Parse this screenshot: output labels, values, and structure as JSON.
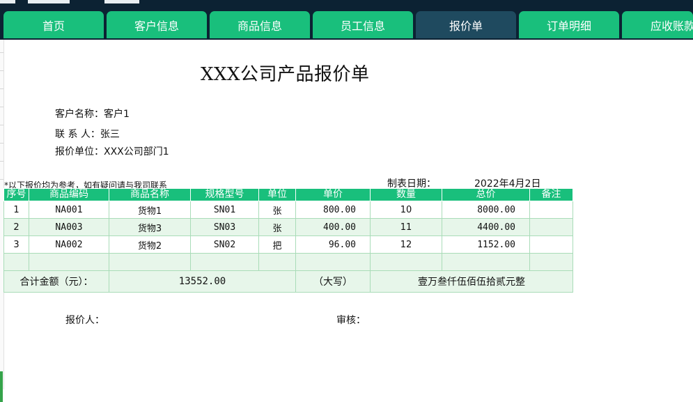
{
  "tabs": [
    {
      "label": "首页",
      "active": false
    },
    {
      "label": "客户信息",
      "active": false
    },
    {
      "label": "商品信息",
      "active": false
    },
    {
      "label": "员工信息",
      "active": false
    },
    {
      "label": "报价单",
      "active": true
    },
    {
      "label": "订单明细",
      "active": false
    },
    {
      "label": "应收账款",
      "active": false
    }
  ],
  "doc": {
    "title": "XXX公司产品报价单",
    "customer_label": "客户名称：",
    "customer_value": "客户1",
    "contact_label": "联 系 人：",
    "contact_value": "张三",
    "unit_label": "报价单位：",
    "unit_value": "XXX公司部门1",
    "note": "*以下报价均为参考，如有疑问请与我司联系",
    "date_label": "制表日期：",
    "date_value": "2022年4月2日"
  },
  "table": {
    "headers": [
      "序号",
      "商品编码",
      "商品名称",
      "规格型号",
      "单位",
      "单价",
      "数量",
      "总价",
      "备注"
    ],
    "rows": [
      [
        "1",
        "NA001",
        "货物1",
        "SN01",
        "张",
        "800.00",
        "10",
        "8000.00",
        ""
      ],
      [
        "2",
        "NA003",
        "货物3",
        "SN03",
        "张",
        "400.00",
        "11",
        "4400.00",
        ""
      ],
      [
        "3",
        "NA002",
        "货物2",
        "SN02",
        "把",
        "96.00",
        "12",
        "1152.00",
        ""
      ],
      [
        "",
        "",
        "",
        "",
        "",
        "",
        "",
        "",
        ""
      ]
    ],
    "total_label": "合计金额（元）：",
    "total_value": "13552.00",
    "upper_label": "（大写）",
    "upper_value": "壹万叁仟伍佰伍拾贰元整"
  },
  "footer": {
    "quoter_label": "报价人：",
    "reviewer_label": "审核："
  },
  "colors": {
    "tab_green": "#19bf7c",
    "tab_active": "#1f4a5f",
    "header_band": "#0c2233",
    "row_alt": "#e7f6ea"
  }
}
